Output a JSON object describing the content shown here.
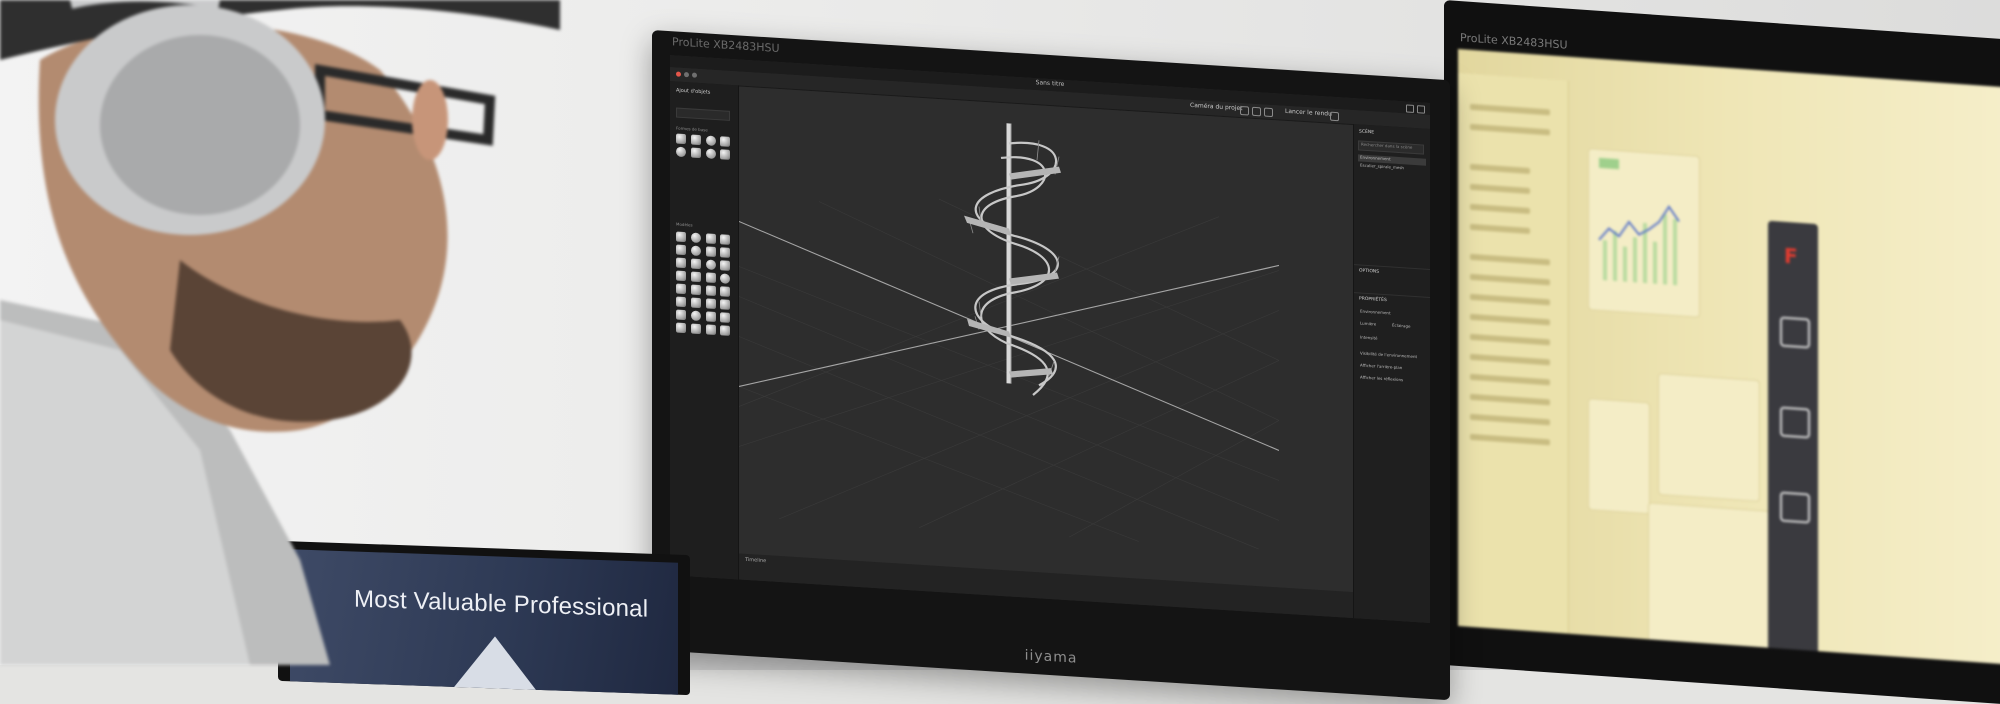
{
  "laptop": {
    "screen_text": "Most Valuable Professional"
  },
  "main_monitor": {
    "brand_bottom": "iiyama",
    "brand_top": "ProLite XB2483HSU",
    "app": {
      "window_title": "Sans titre",
      "toolbar": {
        "select_value": "Caméra du projet",
        "right_label": "Lancer le rendu"
      },
      "left_panel": {
        "title": "Ajout d'objets",
        "section_shapes": "Formes de base",
        "section_models": "Modèles"
      },
      "right_panel": {
        "scene_heading": "SCÈNE",
        "search_placeholder": "Rechercher dans la scène",
        "scene_items": [
          "Environnement",
          "Escalier_spirale_mesh"
        ],
        "options_heading": "OPTIONS",
        "properties_heading": "PROPRIÉTÉS",
        "environment_label": "Environnement",
        "tabs": [
          "Lumière",
          "Éclairage"
        ],
        "field_label": "Intensité",
        "section_title": "Visibilité de l'environnement",
        "check_label_1": "Afficher l'arrière-plan",
        "check_label_2": "Afficher les réflexions"
      },
      "bottom": {
        "label": "Timeline"
      }
    }
  },
  "right_monitor": {
    "brand_top": "ProLite XB2483HSU"
  },
  "colors": {
    "viewport_bg": "#2d2d2d",
    "right_screen_tint": "#efe6b6",
    "mvp_banner": "#2e3a55"
  }
}
